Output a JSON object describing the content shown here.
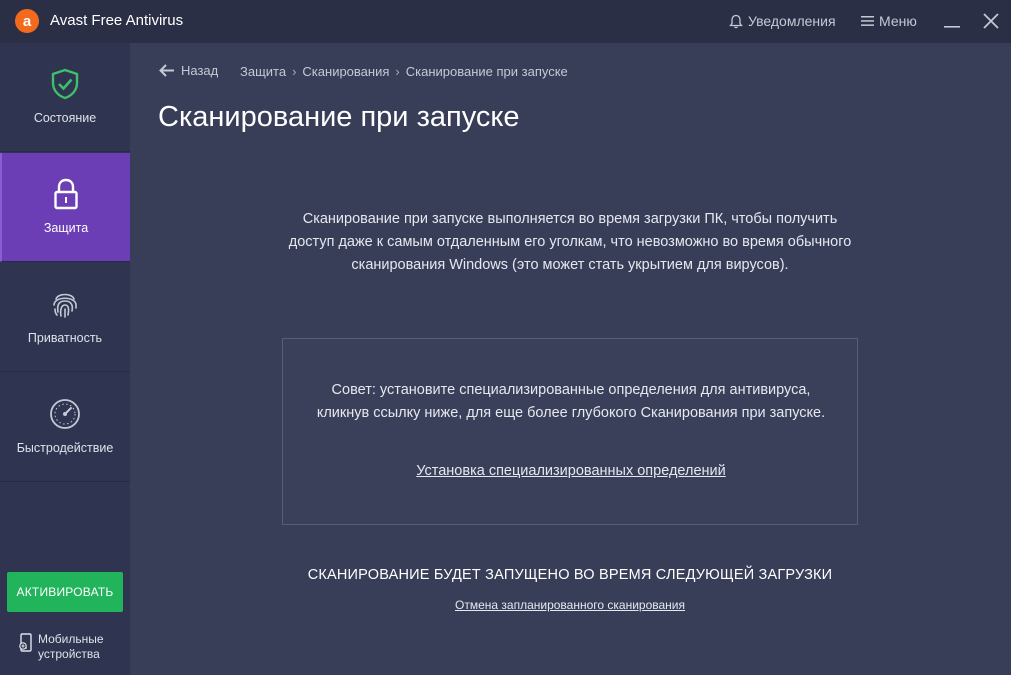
{
  "window": {
    "title": "Avast Free Antivirus",
    "notifications_label": "Уведомления",
    "menu_label": "Меню"
  },
  "sidebar": {
    "items": [
      {
        "label": "Состояние",
        "icon": "shield-check-icon"
      },
      {
        "label": "Защита",
        "icon": "lock-icon",
        "active": true
      },
      {
        "label": "Приватность",
        "icon": "fingerprint-icon"
      },
      {
        "label": "Быстродействие",
        "icon": "speedometer-icon"
      }
    ],
    "activate_label": "АКТИВИРОВАТЬ",
    "mobile_label": "Мобильные устройства"
  },
  "breadcrumb": {
    "back_label": "Назад",
    "items": [
      "Защита",
      "Сканирования",
      "Сканирование при запуске"
    ]
  },
  "main": {
    "title": "Сканирование при запуске",
    "description": "Сканирование при запуске выполняется во время загрузки ПК, чтобы получить доступ даже к самым отдаленным его уголкам, что невозможно во время обычного сканирования Windows (это может стать укрытием для вирусов).",
    "tip_text": "Совет: установите специализированные определения для антивируса, кликнув ссылку ниже, для еще более глубокого Сканирования при запуске.",
    "tip_link": "Установка специализированных определений",
    "status": "СКАНИРОВАНИЕ БУДЕТ ЗАПУЩЕНО ВО ВРЕМЯ СЛЕДУЮЩЕЙ ЗАГРУЗКИ",
    "cancel_link": "Отмена запланированного сканирования"
  },
  "colors": {
    "brand_orange": "#f26b1d",
    "active_nav": "#6b3eb5",
    "activate_green": "#22b45b",
    "status_green": "#3fbf6b",
    "background": "#383e58",
    "sidebar": "#2f3550",
    "titlebar": "#2a2f46"
  }
}
